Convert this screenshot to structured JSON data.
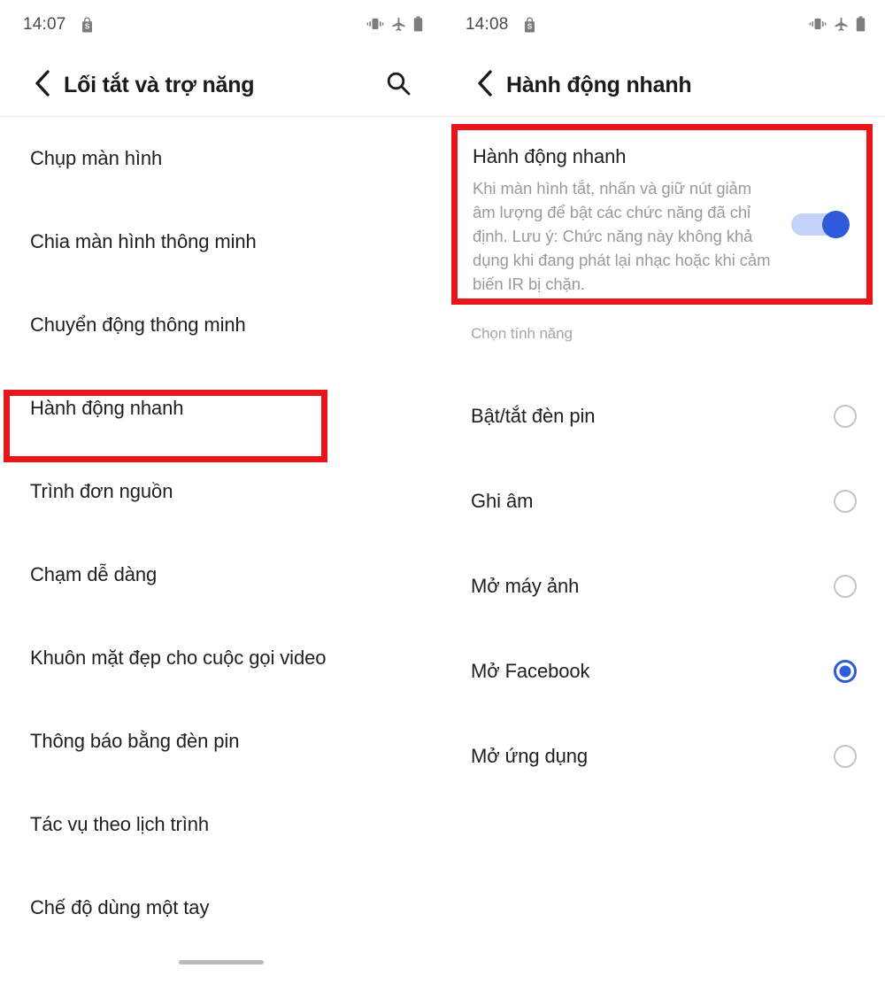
{
  "left_screen": {
    "status_bar": {
      "time": "14:07",
      "app_icon": "shopping-bag-icon",
      "icons": [
        "vibrate-icon",
        "airplane-mode-icon",
        "battery-icon"
      ]
    },
    "header": {
      "back_icon": "back-chevron-icon",
      "title": "Lối tắt và trợ năng",
      "search_icon": "search-icon"
    },
    "items": [
      {
        "label": "Chụp màn hình",
        "highlighted": false
      },
      {
        "label": "Chia màn hình thông minh",
        "highlighted": false
      },
      {
        "label": "Chuyển động thông minh",
        "highlighted": false
      },
      {
        "label": "Hành động nhanh",
        "highlighted": true
      },
      {
        "label": "Trình đơn nguồn",
        "highlighted": false
      },
      {
        "label": "Chạm dễ dàng",
        "highlighted": false
      },
      {
        "label": "Khuôn mặt đẹp cho cuộc gọi video",
        "highlighted": false
      },
      {
        "label": "Thông báo bằng đèn pin",
        "highlighted": false
      },
      {
        "label": "Tác vụ theo lịch trình",
        "highlighted": false
      },
      {
        "label": "Chế độ dùng một tay",
        "highlighted": false
      }
    ]
  },
  "right_screen": {
    "status_bar": {
      "time": "14:08",
      "app_icon": "shopping-bag-icon",
      "icons": [
        "vibrate-icon",
        "airplane-mode-icon",
        "battery-icon"
      ]
    },
    "header": {
      "back_icon": "back-chevron-icon",
      "title": "Hành động nhanh"
    },
    "feature_card": {
      "title": "Hành động nhanh",
      "description": "Khi màn hình tắt, nhấn và giữ nút giảm âm lượng để bật các chức năng đã chỉ định. Lưu ý: Chức năng này không khả dụng khi đang phát lại nhạc hoặc khi cảm biến IR bị chặn.",
      "toggle_on": true,
      "highlighted": true
    },
    "section_label": "Chọn tính năng",
    "options": [
      {
        "label": "Bật/tắt đèn pin",
        "selected": false
      },
      {
        "label": "Ghi âm",
        "selected": false
      },
      {
        "label": "Mở máy ảnh",
        "selected": false
      },
      {
        "label": "Mở Facebook",
        "selected": true
      },
      {
        "label": "Mở ứng dụng",
        "selected": false
      }
    ]
  },
  "colors": {
    "accent": "#2f5ad9",
    "highlight_box": "#e8161b",
    "toggle_track": "#c3d3f8",
    "secondary_text": "#9a9a9a",
    "primary_text": "#1f1f1f"
  }
}
